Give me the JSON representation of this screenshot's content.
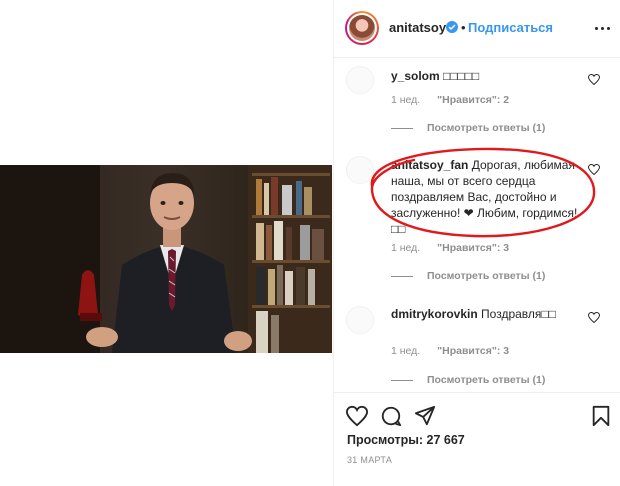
{
  "header": {
    "username": "anitatsoy",
    "separator": "•",
    "follow_label": "Подписаться"
  },
  "comments": [
    {
      "username": "y_solom",
      "text": "□□□□□",
      "time": "1 нед.",
      "likes": "\"Нравится\": 2",
      "reply": "",
      "view_replies": "Посмотреть ответы (1)"
    },
    {
      "username": "anitatsoy_fan",
      "text": "Дорогая, любимая наша, мы от всего сердца поздравляем Вас, достойно и заслуженно! ❤ Любим, гордимся! □□",
      "time": "1 нед.",
      "likes": "\"Нравится\": 3",
      "reply": "",
      "view_replies": "Посмотреть ответы (1)"
    },
    {
      "username": "dmitrykorovkin",
      "text": "Поздравля□□",
      "time": "1 нед.",
      "likes": "\"Нравится\": 3",
      "reply": "",
      "view_replies": "Посмотреть ответы (1)"
    }
  ],
  "post": {
    "views": "Просмотры: 27 667",
    "date": "31 МАРТА"
  },
  "colors": {
    "accent": "#3897f0",
    "annotation": "#e0191c",
    "muted": "#8e8e8e",
    "text": "#262626"
  },
  "icons": {
    "verified": "verified-badge-icon",
    "more": "more-options-icon",
    "heart": "heart-icon",
    "comment": "comment-icon",
    "share": "share-icon",
    "bookmark": "bookmark-icon"
  }
}
